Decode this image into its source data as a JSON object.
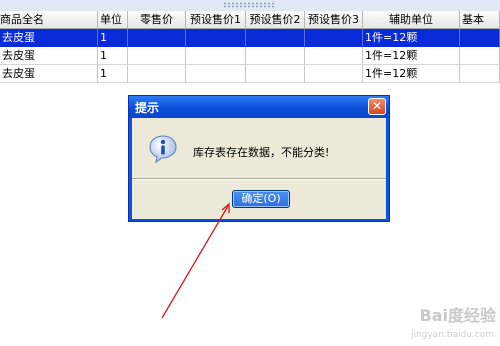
{
  "table": {
    "headers": {
      "name": "商品全名",
      "unit": "单位",
      "retail_price": "零售价",
      "preset_price1": "预设售价1",
      "preset_price2": "预设售价2",
      "preset_price3": "预设售价3",
      "aux_unit": "辅助单位",
      "base": "基本"
    },
    "rows": [
      {
        "name": "去皮蛋",
        "unit": "1",
        "aux_unit": "1件=12颗",
        "selected": true
      },
      {
        "name": "去皮蛋",
        "unit": "1",
        "aux_unit": "1件=12颗",
        "selected": false
      },
      {
        "name": "去皮蛋",
        "unit": "1",
        "aux_unit": "1件=12颗",
        "selected": false
      }
    ]
  },
  "dialog": {
    "title": "提示",
    "message": "库存表存在数据，不能分类!",
    "ok_label": "确定(O)",
    "close_glyph": "✕",
    "icon": "info-icon"
  },
  "annotation": {
    "color": "#d01a1a"
  },
  "watermark": {
    "brand": "Bai度经验",
    "url": "jingyan.baidu.com"
  }
}
